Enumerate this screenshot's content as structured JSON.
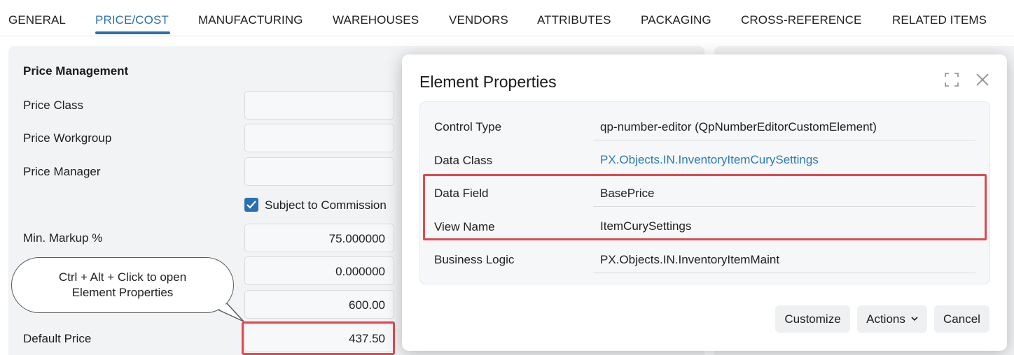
{
  "tabs": [
    {
      "label": "GENERAL",
      "active": false
    },
    {
      "label": "PRICE/COST",
      "active": true
    },
    {
      "label": "MANUFACTURING",
      "active": false
    },
    {
      "label": "WAREHOUSES",
      "active": false
    },
    {
      "label": "VENDORS",
      "active": false
    },
    {
      "label": "ATTRIBUTES",
      "active": false
    },
    {
      "label": "PACKAGING",
      "active": false
    },
    {
      "label": "CROSS-REFERENCE",
      "active": false
    },
    {
      "label": "RELATED ITEMS",
      "active": false
    }
  ],
  "price_management": {
    "title": "Price Management",
    "price_class_label": "Price Class",
    "price_class_value": "",
    "price_workgroup_label": "Price Workgroup",
    "price_workgroup_value": "",
    "price_manager_label": "Price Manager",
    "price_manager_value": "",
    "subject_to_commission_label": "Subject to Commission",
    "subject_to_commission_checked": true,
    "min_markup_label": "Min. Markup %",
    "min_markup_value": "75.000000",
    "field6_value": "0.000000",
    "field7_value": "600.00",
    "default_price_label": "Default Price",
    "default_price_value": "437.50"
  },
  "callout": {
    "line1": "Ctrl + Alt + Click to open",
    "line2": "Element Properties"
  },
  "modal": {
    "title": "Element Properties",
    "properties": [
      {
        "label": "Control Type",
        "value": "qp-number-editor (QpNumberEditorCustomElement)",
        "link": false
      },
      {
        "label": "Data Class",
        "value": "PX.Objects.IN.InventoryItemCurySettings",
        "link": true
      },
      {
        "label": "Data Field",
        "value": "BasePrice",
        "link": false
      },
      {
        "label": "View Name",
        "value": "ItemCurySettings",
        "link": false
      },
      {
        "label": "Business Logic",
        "value": "PX.Objects.IN.InventoryItemMaint",
        "link": false
      }
    ],
    "buttons": {
      "customize": "Customize",
      "actions": "Actions",
      "cancel": "Cancel"
    }
  },
  "colors": {
    "accent": "#2a6fb0",
    "highlight": "#e04a4f",
    "link": "#2a7ab8"
  }
}
